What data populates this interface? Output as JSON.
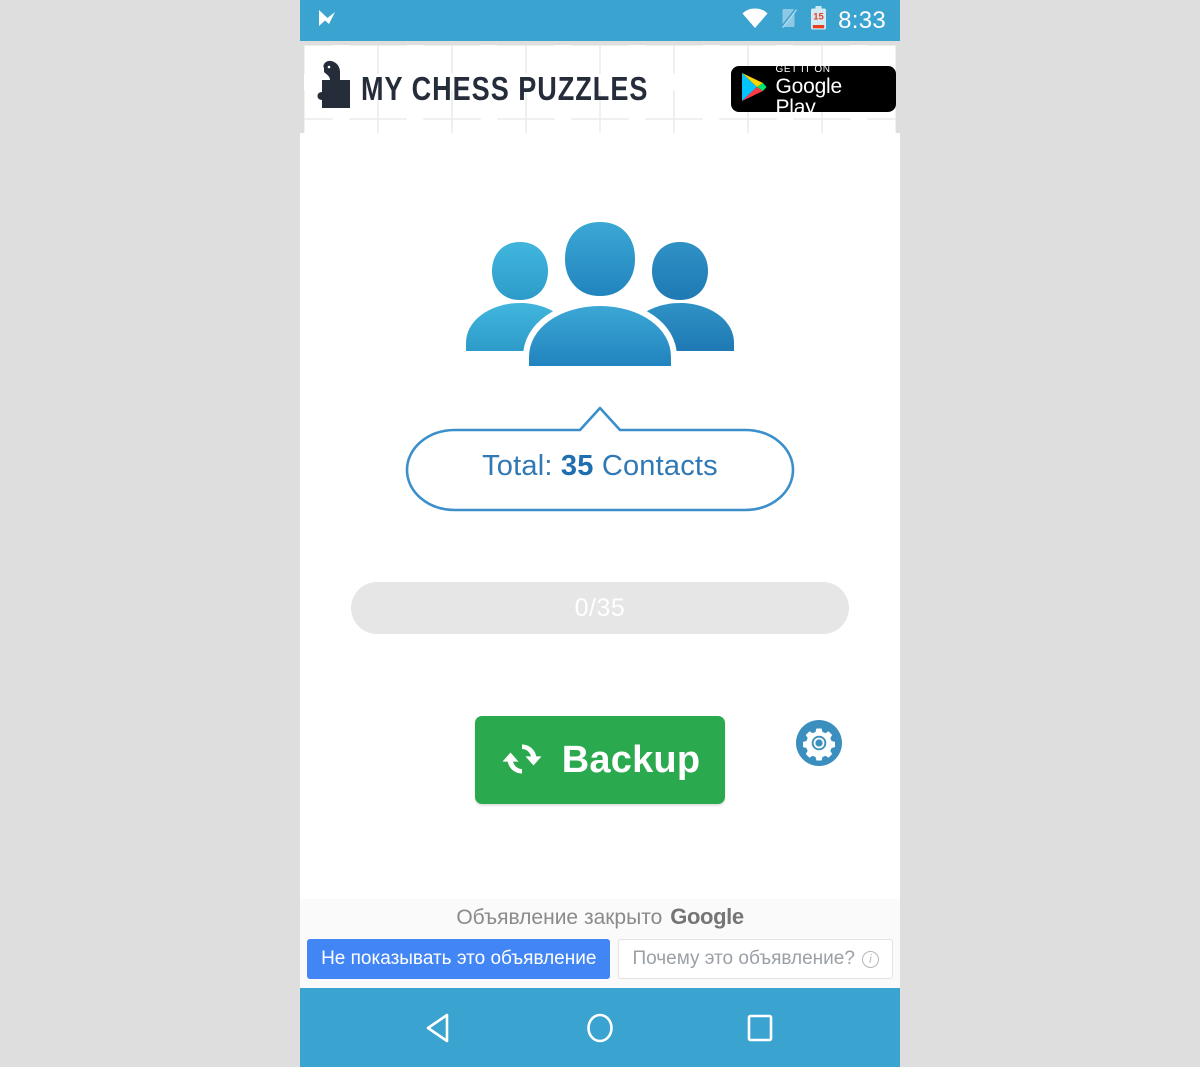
{
  "status_bar": {
    "notification_icon": "checkmark-flag-icon",
    "wifi_icon": "wifi-icon",
    "signal_icon": "signal-off-icon",
    "battery_icon": "battery-low-icon",
    "battery_level": "15",
    "time": "8:33",
    "background_color": "#3ba3d0"
  },
  "banner_ad": {
    "logo_icon": "chess-knight-puzzle-icon",
    "title": "MY CHESS PUZZLES",
    "store_badge": {
      "icon": "google-play-icon",
      "line1": "GET IT ON",
      "line2": "Google Play"
    },
    "background_pattern": "jigsaw-puzzle-pattern"
  },
  "main": {
    "contacts_icon": "three-people-icon",
    "total_bubble": {
      "prefix": "Total:",
      "count": "35",
      "suffix": "Contacts",
      "text_color": "#3079b5"
    },
    "progress": {
      "label": "0/35",
      "current": 0,
      "total": 35,
      "percent": 0,
      "track_color": "#e6e6e6"
    },
    "backup_button": {
      "icon": "sync-refresh-icon",
      "label": "Backup",
      "color": "#2ba94f"
    },
    "settings_button": {
      "icon": "gear-icon",
      "color": "#3b8fbf"
    }
  },
  "ad_footer": {
    "closed_text": "Объявление закрыто",
    "brand": "Google",
    "dismiss_button": "Не показывать это объявление",
    "why_button": "Почему это объявление?",
    "info_icon": "info-icon",
    "dismiss_color": "#4285f4"
  },
  "nav_bar": {
    "back_icon": "back-triangle-icon",
    "home_icon": "home-circle-icon",
    "recents_icon": "recents-square-icon",
    "background_color": "#3ba3d0"
  }
}
